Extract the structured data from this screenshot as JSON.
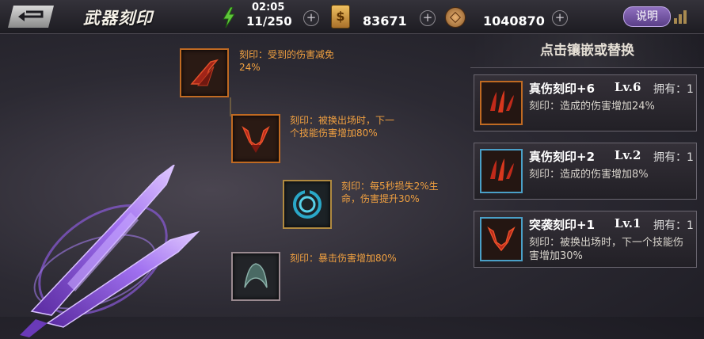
{
  "header": {
    "title": "武器刻印",
    "time": "02:05",
    "stamina": "11/250",
    "gold": "83671",
    "silver": "1040870",
    "help_label": "说明",
    "plus_symbol": "+",
    "coin_symbol": "$"
  },
  "slots": [
    {
      "desc": "刻印：受到的伤害减免24%",
      "icon": "claw-slash-icon"
    },
    {
      "desc": "刻印：被换出场时，下一个技能伤害增加80%",
      "icon": "horned-crest-icon"
    },
    {
      "desc": "刻印：每5秒损失2%生命，伤害提升30%",
      "icon": "ring-shield-icon"
    },
    {
      "desc": "刻印：暴击伤害增加80%",
      "icon": "crescent-icon"
    }
  ],
  "panel": {
    "title": "点击镶嵌或替换",
    "cards": [
      {
        "name": "真伤刻印+6",
        "level": "Lv.6",
        "owned": "拥有：1",
        "desc": "刻印：造成的伤害增加24%",
        "icon": "triple-claw-icon"
      },
      {
        "name": "真伤刻印+2",
        "level": "Lv.2",
        "owned": "拥有：1",
        "desc": "刻印：造成的伤害增加8%",
        "icon": "triple-claw-icon"
      },
      {
        "name": "突袭刻印+1",
        "level": "Lv.1",
        "owned": "拥有：1",
        "desc": "刻印：被换出场时，下一个技能伤害增加30%",
        "icon": "horned-crest-icon"
      }
    ]
  },
  "colors": {
    "accent_orange": "#f0a040",
    "help_purple": "#7a5aa8"
  }
}
